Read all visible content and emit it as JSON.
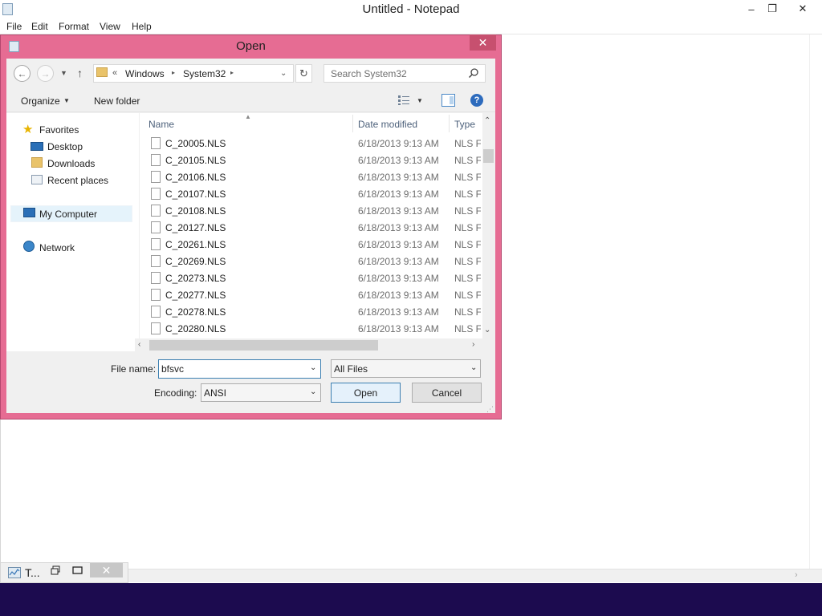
{
  "notepad": {
    "title": "Untitled - Notepad",
    "menu": [
      "File",
      "Edit",
      "Format",
      "View",
      "Help"
    ],
    "minimize_glyph": "–",
    "restore_glyph": "❐",
    "close_glyph": "✕"
  },
  "minimized_window": {
    "title": "T...",
    "close_glyph": "✕"
  },
  "dialog": {
    "title": "Open",
    "close_glyph": "✕",
    "address": {
      "overflow": "«",
      "crumbs": [
        "Windows",
        "System32"
      ],
      "separator": "▸"
    },
    "search_placeholder": "Search System32",
    "toolbar": {
      "organize": "Organize",
      "new_folder": "New folder"
    },
    "nav_pane": {
      "favorites": "Favorites",
      "desktop": "Desktop",
      "downloads": "Downloads",
      "recent_places": "Recent places",
      "my_computer": "My Computer",
      "network": "Network"
    },
    "columns": {
      "name": "Name",
      "date_modified": "Date modified",
      "type": "Type"
    },
    "files": [
      {
        "name": "C_20005.NLS",
        "date": "6/18/2013 9:13 AM",
        "type": "NLS Fi"
      },
      {
        "name": "C_20105.NLS",
        "date": "6/18/2013 9:13 AM",
        "type": "NLS Fi"
      },
      {
        "name": "C_20106.NLS",
        "date": "6/18/2013 9:13 AM",
        "type": "NLS Fi"
      },
      {
        "name": "C_20107.NLS",
        "date": "6/18/2013 9:13 AM",
        "type": "NLS Fi"
      },
      {
        "name": "C_20108.NLS",
        "date": "6/18/2013 9:13 AM",
        "type": "NLS Fi"
      },
      {
        "name": "C_20127.NLS",
        "date": "6/18/2013 9:13 AM",
        "type": "NLS Fi"
      },
      {
        "name": "C_20261.NLS",
        "date": "6/18/2013 9:13 AM",
        "type": "NLS Fi"
      },
      {
        "name": "C_20269.NLS",
        "date": "6/18/2013 9:13 AM",
        "type": "NLS Fi"
      },
      {
        "name": "C_20273.NLS",
        "date": "6/18/2013 9:13 AM",
        "type": "NLS Fi"
      },
      {
        "name": "C_20277.NLS",
        "date": "6/18/2013 9:13 AM",
        "type": "NLS Fi"
      },
      {
        "name": "C_20278.NLS",
        "date": "6/18/2013 9:13 AM",
        "type": "NLS Fi"
      },
      {
        "name": "C_20280.NLS",
        "date": "6/18/2013 9:13 AM",
        "type": "NLS Fi"
      }
    ],
    "form": {
      "file_name_label": "File name:",
      "file_name_value": "bfsvc",
      "file_type_value": "All Files",
      "encoding_label": "Encoding:",
      "encoding_value": "ANSI",
      "open_button": "Open",
      "cancel_button": "Cancel"
    }
  },
  "colors": {
    "dialog_frame": "#e66c93",
    "taskbar": "#1c0b4f",
    "selection": "#e5f3fb",
    "accent_blue": "#3c7fb1"
  }
}
